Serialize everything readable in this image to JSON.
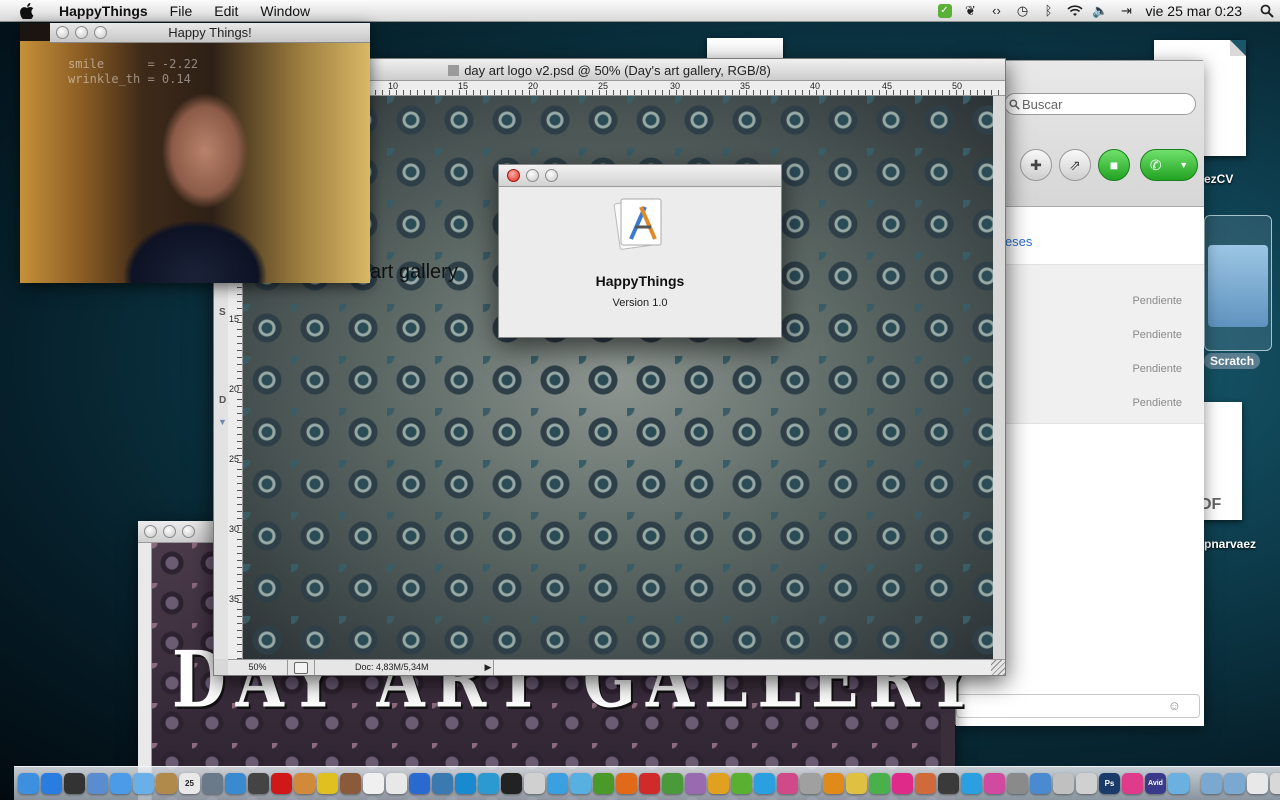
{
  "menubar": {
    "app_name": "HappyThings",
    "menus": [
      "File",
      "Edit",
      "Window"
    ],
    "clock": "vie 25 mar  0:23",
    "status_icons": [
      "evernote-icon",
      "preferences-icon",
      "network-icon",
      "time-machine-icon",
      "bluetooth-icon",
      "wifi-icon",
      "volume-icon",
      "input-source-icon"
    ]
  },
  "webcam_window": {
    "title": "Happy Things!",
    "overlay_text": "smile      = -2.22\nwrinkle_th = 0.14"
  },
  "psd_window": {
    "title": "day art logo v2.psd @ 50% (Day's art gallery, RGB/8)",
    "ruler_h_ticks": [
      "10",
      "15",
      "20",
      "25",
      "30",
      "35",
      "40",
      "45",
      "50"
    ],
    "ruler_v_ticks": [
      "15",
      "20",
      "25",
      "30",
      "35"
    ],
    "left_strip_letters": [
      "S",
      "D"
    ],
    "canvas_text": "art gallery",
    "zoom": "50%",
    "doc_size": "Doc: 4,83M/5,34M"
  },
  "about_dialog": {
    "app_name": "HappyThings",
    "version": "Version 1.0"
  },
  "messaging_window": {
    "search_placeholder": "Buscar",
    "link_text": "s Meses",
    "pending_items": [
      "Pendiente",
      "Pendiente",
      "Pendiente",
      "Pendiente"
    ]
  },
  "back_window": {
    "brand_text": "DAY ART GALLERY"
  },
  "desktop": {
    "file_label_1": "ezCV",
    "folder_label": "Scratch",
    "pdf_tag": "DF",
    "file_label_2": "r pnarvaez"
  },
  "dock": {
    "icons": [
      {
        "name": "finder-icon",
        "color": "#3d8fe0"
      },
      {
        "name": "app-store-icon",
        "color": "#2a7de0"
      },
      {
        "name": "dashboard-icon",
        "color": "#333333"
      },
      {
        "name": "mail-icon",
        "color": "#5a8dd0"
      },
      {
        "name": "safari-icon",
        "color": "#4a9be8"
      },
      {
        "name": "ichat-icon",
        "color": "#6ab0e8"
      },
      {
        "name": "address-book-icon",
        "color": "#b08a4a"
      },
      {
        "name": "ical-icon",
        "color": "#e8e8e8"
      },
      {
        "name": "preview-icon",
        "color": "#6a7a8a"
      },
      {
        "name": "itunes-icon",
        "color": "#3a8ad0"
      },
      {
        "name": "photo-booth-icon",
        "color": "#444444"
      },
      {
        "name": "opera-icon",
        "color": "#d01818"
      },
      {
        "name": "photos-icon",
        "color": "#d08a3a"
      },
      {
        "name": "adium-icon",
        "color": "#e0c020"
      },
      {
        "name": "books-icon",
        "color": "#8a5a3a"
      },
      {
        "name": "textedit-icon",
        "color": "#f0f0f0"
      },
      {
        "name": "scripts-icon",
        "color": "#e8e8e8"
      },
      {
        "name": "dropbox-icon",
        "color": "#2a6ad0"
      },
      {
        "name": "colloquy-icon",
        "color": "#3a7ab0"
      },
      {
        "name": "quicktime-icon",
        "color": "#1a8ad0"
      },
      {
        "name": "itunes-2-icon",
        "color": "#2a9ad0"
      },
      {
        "name": "camera-icon",
        "color": "#222222"
      },
      {
        "name": "screenshot-icon",
        "color": "#d0d0d0"
      },
      {
        "name": "wave-icon",
        "color": "#3aa0e0"
      },
      {
        "name": "twitter-icon",
        "color": "#58b0e0"
      },
      {
        "name": "growl-icon",
        "color": "#4a9a2a"
      },
      {
        "name": "firefox-icon",
        "color": "#e06a1a"
      },
      {
        "name": "mozy-icon",
        "color": "#d02a2a"
      },
      {
        "name": "chrome-icon",
        "color": "#4a9a3a"
      },
      {
        "name": "vienna-icon",
        "color": "#9a6ab0"
      },
      {
        "name": "google-chrome-icon",
        "color": "#e0a020"
      },
      {
        "name": "spotify-icon",
        "color": "#5ab030"
      },
      {
        "name": "skype-icon",
        "color": "#2aa0e0"
      },
      {
        "name": "flickr-icon",
        "color": "#d04a8a"
      },
      {
        "name": "automator-icon",
        "color": "#a0a0a0"
      },
      {
        "name": "vlc-icon",
        "color": "#e08a1a"
      },
      {
        "name": "sketch-icon",
        "color": "#e0c040"
      },
      {
        "name": "evernote-icon",
        "color": "#4ab04a"
      },
      {
        "name": "candy-icon",
        "color": "#e02a8a"
      },
      {
        "name": "giftbox-icon",
        "color": "#d06a3a"
      },
      {
        "name": "adobe-icon",
        "color": "#3a3a3a"
      },
      {
        "name": "skype-2-icon",
        "color": "#2aa0e0"
      },
      {
        "name": "itunes-3-icon",
        "color": "#d04aa0"
      },
      {
        "name": "system-preferences-icon",
        "color": "#8a8a8a"
      },
      {
        "name": "xcode-icon",
        "color": "#4a8ad0"
      },
      {
        "name": "instruments-icon",
        "color": "#c0c0c0"
      },
      {
        "name": "help-icon",
        "color": "#d0d0d0"
      },
      {
        "name": "photoshop-icon",
        "color": "#1a3a6a"
      },
      {
        "name": "petals-icon",
        "color": "#e03a8a"
      },
      {
        "name": "avid-icon",
        "color": "#3a3a8a"
      },
      {
        "name": "users-icon",
        "color": "#6ab0e0"
      }
    ],
    "folders": [
      {
        "name": "applications-folder-icon",
        "color": "#7aa8d0"
      },
      {
        "name": "documents-folder-icon",
        "color": "#7aa8d0"
      },
      {
        "name": "downloads-stack-icon",
        "color": "#e8e8e8"
      },
      {
        "name": "trash-icon",
        "color": "#d8d8d8"
      },
      {
        "name": "trash-2-icon",
        "color": "#c8c8c8"
      }
    ],
    "labels": {
      "ical_day": "25",
      "photoshop": "Ps",
      "avid": "Avid"
    }
  }
}
